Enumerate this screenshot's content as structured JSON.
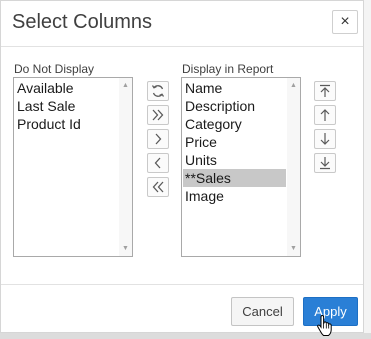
{
  "dialog": {
    "title": "Select Columns",
    "close_label": "×"
  },
  "left_list": {
    "label": "Do Not Display",
    "items": [
      "Available",
      "Last Sale",
      "Product Id"
    ]
  },
  "right_list": {
    "label": "Display in Report",
    "items": [
      "Name",
      "Description",
      "Category",
      "Price",
      "Units",
      "**Sales",
      "Image"
    ],
    "selected_index": 5
  },
  "transfer_controls": [
    "refresh-icon",
    "move-all-right-icon",
    "move-right-icon",
    "move-left-icon",
    "move-all-left-icon"
  ],
  "order_controls": [
    "move-top-icon",
    "move-up-icon",
    "move-down-icon",
    "move-bottom-icon"
  ],
  "footer": {
    "cancel_label": "Cancel",
    "apply_label": "Apply"
  },
  "colors": {
    "accent": "#2a7fd6",
    "selection": "#c8c8c8"
  }
}
